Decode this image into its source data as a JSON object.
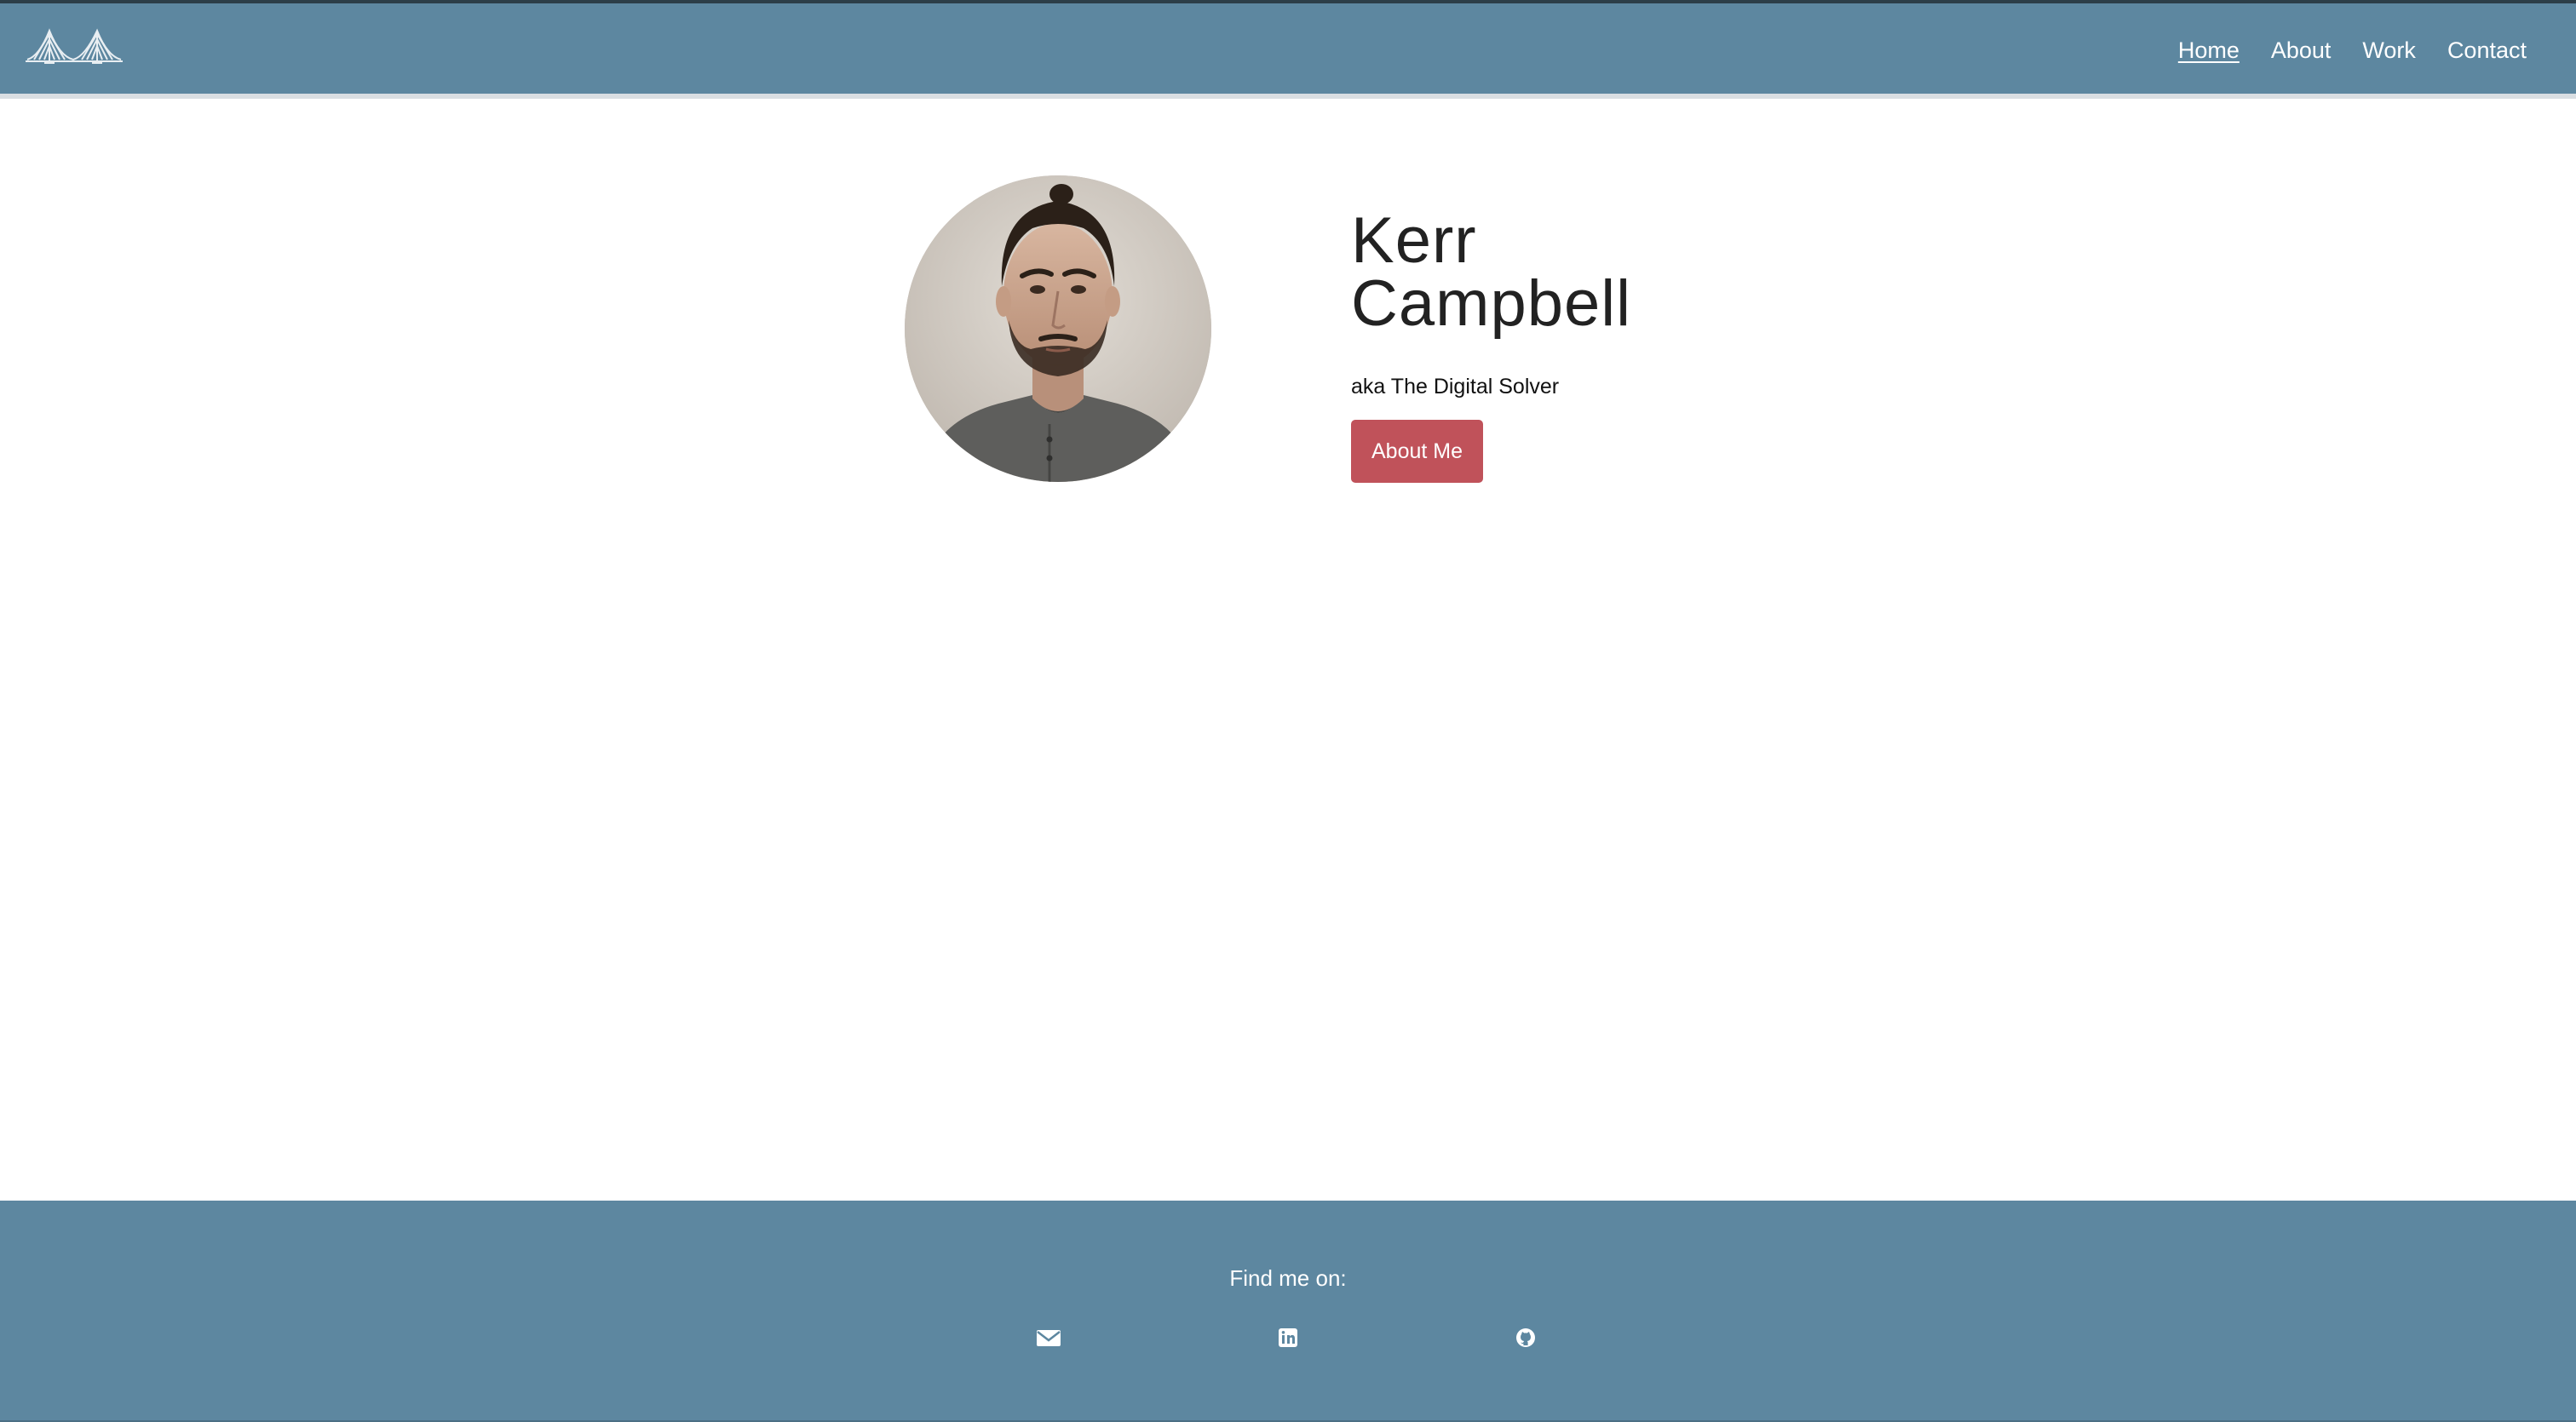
{
  "header": {
    "logo_icon": "bridge-logo-icon",
    "nav": [
      {
        "label": "Home",
        "active": true
      },
      {
        "label": "About",
        "active": false
      },
      {
        "label": "Work",
        "active": false
      },
      {
        "label": "Contact",
        "active": false
      }
    ]
  },
  "hero": {
    "first_name": "Kerr",
    "last_name": "Campbell",
    "tagline": "aka The Digital Solver",
    "button_label": "About Me"
  },
  "footer": {
    "title": "Find me on:",
    "links": [
      {
        "icon": "mail-icon"
      },
      {
        "icon": "linkedin-icon"
      },
      {
        "icon": "github-icon"
      }
    ]
  },
  "colors": {
    "header_bg": "#5d87a0",
    "button_bg": "#c0525a",
    "text_dark": "#222222"
  }
}
